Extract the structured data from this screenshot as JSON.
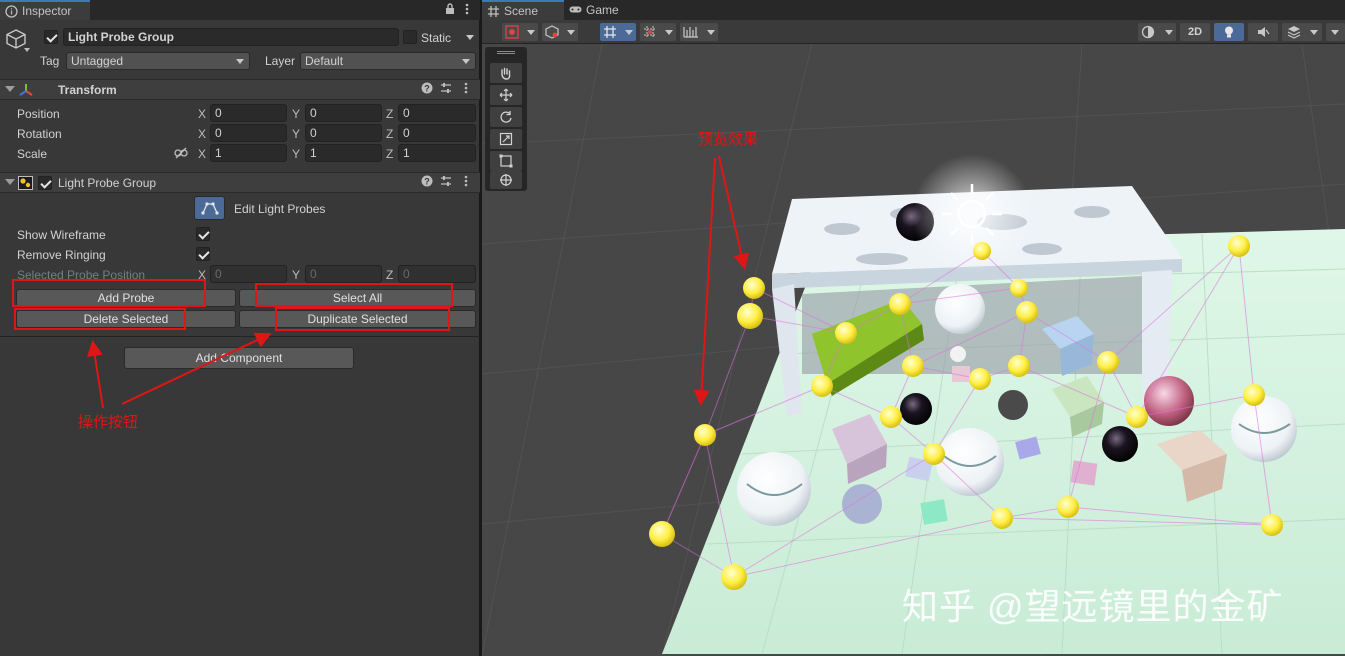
{
  "tabs": {
    "inspector": "Inspector",
    "scene": "Scene",
    "game": "Game"
  },
  "object": {
    "name": "Light Probe Group",
    "static_label": "Static",
    "tag_label": "Tag",
    "tag_value": "Untagged",
    "layer_label": "Layer",
    "layer_value": "Default"
  },
  "transform": {
    "title": "Transform",
    "rows": [
      {
        "label": "Position",
        "x": "0",
        "y": "0",
        "z": "0"
      },
      {
        "label": "Rotation",
        "x": "0",
        "y": "0",
        "z": "0"
      },
      {
        "label": "Scale",
        "x": "1",
        "y": "1",
        "z": "1"
      }
    ],
    "axis_x": "X",
    "axis_y": "Y",
    "axis_z": "Z"
  },
  "lpg": {
    "title": "Light Probe Group",
    "edit_label": "Edit Light Probes",
    "show_wireframe": "Show Wireframe",
    "remove_ringing": "Remove Ringing",
    "selected_pos": "Selected Probe Position",
    "sel_x": "0",
    "sel_y": "0",
    "sel_z": "0",
    "add_probe": "Add Probe",
    "select_all": "Select All",
    "delete_selected": "Delete Selected",
    "duplicate_selected": "Duplicate Selected"
  },
  "add_component": "Add Component",
  "annotations": {
    "ops": "操作按钮",
    "preview": "预览效果"
  },
  "scene_toolbar": {
    "mode_2d": "2D"
  },
  "watermark": "知乎 @望远镜里的金矿",
  "colors": {
    "accent": "#3a79bb",
    "annotation": "#e01515",
    "probe": "#ffee44"
  }
}
